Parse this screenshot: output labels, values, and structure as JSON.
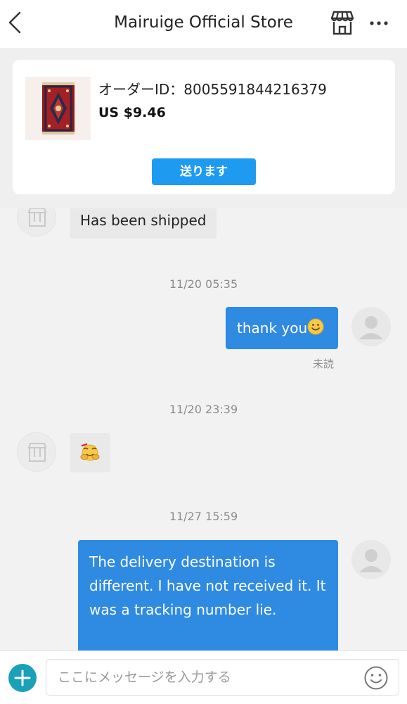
{
  "header": {
    "title": "Mairuige Official Store",
    "back_icon": "chevron-left-icon",
    "store_icon": "storefront-icon",
    "more_icon": "ellipsis-icon"
  },
  "order": {
    "id_text": "オーダーID：8005591844216379",
    "price": "US $9.46",
    "ship_button": "送ります",
    "thumbnail_icon": "rug-product-image"
  },
  "messages": [
    {
      "from": "store",
      "text": "Has been shipped"
    },
    {
      "timestamp": "11/20 05:35"
    },
    {
      "from": "user",
      "text": "thank you",
      "emoji": "smiling-face",
      "status": "未読"
    },
    {
      "timestamp": "11/20 23:39"
    },
    {
      "from": "store",
      "emoji": "hugging-face"
    },
    {
      "timestamp": "11/27 15:59"
    },
    {
      "from": "user",
      "text": "The delivery destination is different. I have not received it. It was a tracking number lie."
    }
  ],
  "input": {
    "placeholder": "ここにメッセージを入力する",
    "value": "",
    "plus_icon": "plus-icon",
    "emoji_icon": "smiley-icon"
  },
  "colors": {
    "accent_blue": "#1e9bf0",
    "out_bubble": "#2f8ae2",
    "in_bubble": "#e9e9e9",
    "plus_teal": "#1aa0b8"
  }
}
